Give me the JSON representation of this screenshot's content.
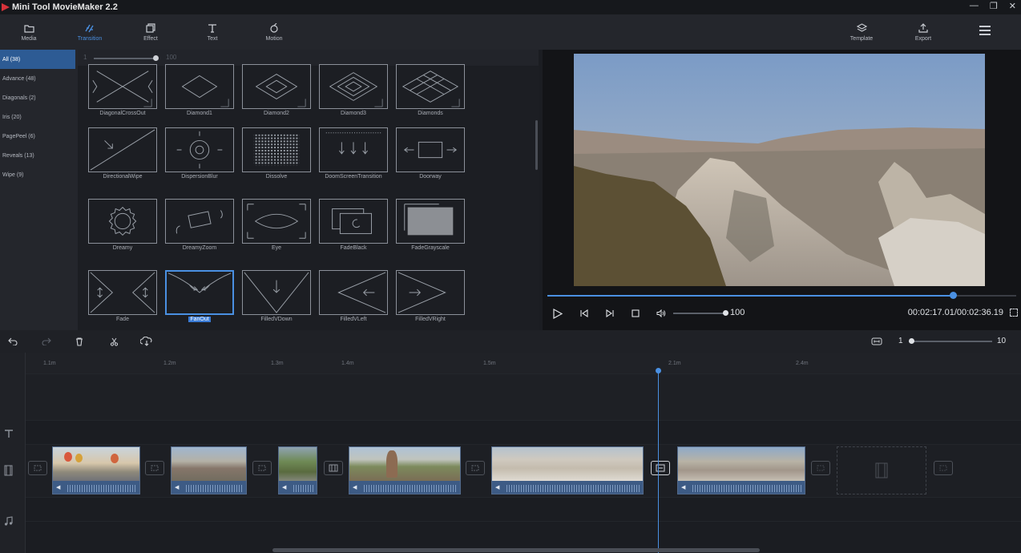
{
  "app": {
    "title": "Mini Tool MovieMaker 2.2"
  },
  "window_controls": [
    "—",
    "❐",
    "✕"
  ],
  "toolbar": {
    "items": [
      {
        "label": "Media",
        "icon": "folder-icon"
      },
      {
        "label": "Transition",
        "icon": "transition-icon",
        "active": true
      },
      {
        "label": "Effect",
        "icon": "effect-icon"
      },
      {
        "label": "Text",
        "icon": "text-icon"
      },
      {
        "label": "Motion",
        "icon": "motion-icon"
      }
    ],
    "right": [
      {
        "label": "Template",
        "icon": "template-icon"
      },
      {
        "label": "Export",
        "icon": "export-icon"
      }
    ]
  },
  "categories": [
    {
      "label": "All (38)",
      "active": true
    },
    {
      "label": "Advance (48)"
    },
    {
      "label": "Diagonals (2)"
    },
    {
      "label": "Iris (20)"
    },
    {
      "label": "PagePeel (6)"
    },
    {
      "label": "Reveals (13)"
    },
    {
      "label": "Wipe (9)"
    }
  ],
  "thumb_zoom": {
    "min": "1",
    "max": "100"
  },
  "transitions": [
    "DiagonalCrossOut",
    "Diamond1",
    "Diamond2",
    "Diamond3",
    "Diamonds",
    "DirectionalWipe",
    "DispersionBlur",
    "Dissolve",
    "DoomScreenTransition",
    "Doorway",
    "Dreamy",
    "DreamyZoom",
    "Eye",
    "FadeBlack",
    "FadeGrayscale",
    "Fade",
    "FanOut",
    "FilledVDown",
    "FilledVLeft",
    "FilledVRight"
  ],
  "selected_transition": "FanOut",
  "player": {
    "volume": "100",
    "volume_fraction": 0.97,
    "progress_fraction": 0.87,
    "time_current": "00:02:17.01",
    "time_total": "00:02:36.19",
    "time_display": "00:02:17.01/00:02:36.19"
  },
  "timeline_zoom": {
    "min": "1",
    "max": "10",
    "value_fraction": 0.0
  },
  "ruler_ticks": [
    "1.1m",
    "1.2m",
    "1.3m",
    "1.4m",
    "1.5m",
    "2.1m",
    "2.4m"
  ],
  "colors": {
    "accent": "#4a90e2",
    "selection": "#3a7bd5"
  }
}
